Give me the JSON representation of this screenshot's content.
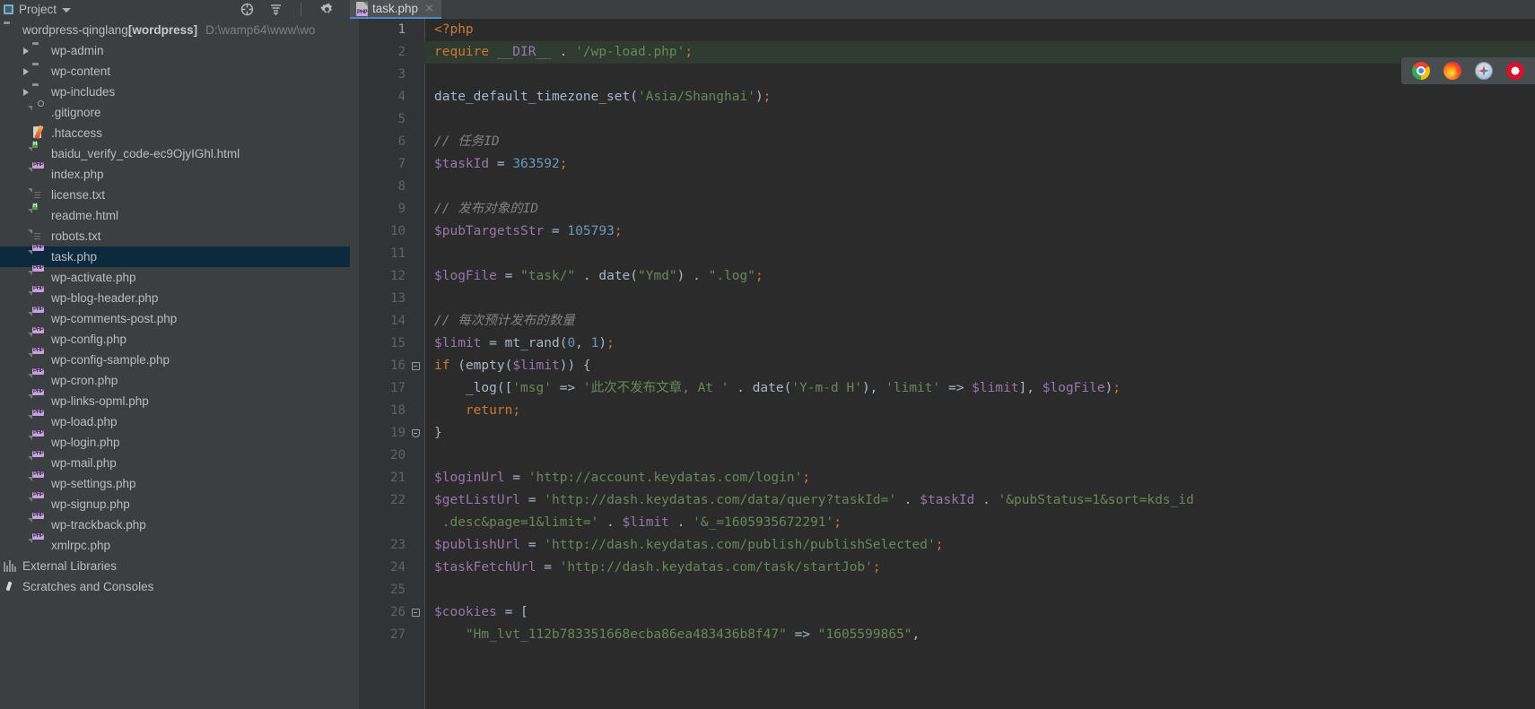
{
  "toolwindow": {
    "title": "Project",
    "icons": [
      "locate-icon",
      "collapse-all-icon",
      "gear-icon",
      "minimize-icon"
    ]
  },
  "editor_tab": {
    "filename": "task.php",
    "icon": "php-file-icon",
    "close": "×"
  },
  "project_tree": [
    {
      "label": "wordpress-qinglang",
      "bold": "[wordpress]",
      "path": "D:\\wamp64\\www\\wo",
      "icon": "folder-icon",
      "indent": 0,
      "arrow": false,
      "selected": false
    },
    {
      "label": "wp-admin",
      "icon": "folder-icon",
      "indent": 1,
      "arrow": true,
      "selected": false
    },
    {
      "label": "wp-content",
      "icon": "folder-icon",
      "indent": 1,
      "arrow": true,
      "selected": false
    },
    {
      "label": "wp-includes",
      "icon": "folder-icon",
      "indent": 1,
      "arrow": true,
      "selected": false
    },
    {
      "label": ".gitignore",
      "icon": "file-ignored-icon",
      "indent": 1,
      "arrow": false,
      "selected": false
    },
    {
      "label": ".htaccess",
      "icon": "htaccess-file-icon",
      "indent": 1,
      "arrow": false,
      "selected": false
    },
    {
      "label": "baidu_verify_code-ec9OjyIGhl.html",
      "icon": "html-file-icon",
      "indent": 1,
      "arrow": false,
      "selected": false
    },
    {
      "label": "index.php",
      "icon": "php-file-icon",
      "indent": 1,
      "arrow": false,
      "selected": false
    },
    {
      "label": "license.txt",
      "icon": "text-file-icon",
      "indent": 1,
      "arrow": false,
      "selected": false
    },
    {
      "label": "readme.html",
      "icon": "html-file-icon",
      "indent": 1,
      "arrow": false,
      "selected": false
    },
    {
      "label": "robots.txt",
      "icon": "text-file-icon",
      "indent": 1,
      "arrow": false,
      "selected": false
    },
    {
      "label": "task.php",
      "icon": "php-file-icon",
      "indent": 1,
      "arrow": false,
      "selected": true
    },
    {
      "label": "wp-activate.php",
      "icon": "php-file-icon",
      "indent": 1,
      "arrow": false,
      "selected": false
    },
    {
      "label": "wp-blog-header.php",
      "icon": "php-file-icon",
      "indent": 1,
      "arrow": false,
      "selected": false
    },
    {
      "label": "wp-comments-post.php",
      "icon": "php-file-icon",
      "indent": 1,
      "arrow": false,
      "selected": false
    },
    {
      "label": "wp-config.php",
      "icon": "php-file-icon",
      "indent": 1,
      "arrow": false,
      "selected": false
    },
    {
      "label": "wp-config-sample.php",
      "icon": "php-file-icon",
      "indent": 1,
      "arrow": false,
      "selected": false
    },
    {
      "label": "wp-cron.php",
      "icon": "php-file-icon",
      "indent": 1,
      "arrow": false,
      "selected": false
    },
    {
      "label": "wp-links-opml.php",
      "icon": "php-file-icon",
      "indent": 1,
      "arrow": false,
      "selected": false
    },
    {
      "label": "wp-load.php",
      "icon": "php-file-icon",
      "indent": 1,
      "arrow": false,
      "selected": false
    },
    {
      "label": "wp-login.php",
      "icon": "php-file-icon",
      "indent": 1,
      "arrow": false,
      "selected": false
    },
    {
      "label": "wp-mail.php",
      "icon": "php-file-icon",
      "indent": 1,
      "arrow": false,
      "selected": false
    },
    {
      "label": "wp-settings.php",
      "icon": "php-file-icon",
      "indent": 1,
      "arrow": false,
      "selected": false
    },
    {
      "label": "wp-signup.php",
      "icon": "php-file-icon",
      "indent": 1,
      "arrow": false,
      "selected": false
    },
    {
      "label": "wp-trackback.php",
      "icon": "php-file-icon",
      "indent": 1,
      "arrow": false,
      "selected": false
    },
    {
      "label": "xmlrpc.php",
      "icon": "php-file-icon",
      "indent": 1,
      "arrow": false,
      "selected": false
    },
    {
      "label": "External Libraries",
      "icon": "external-libraries-icon",
      "indent": 0,
      "arrow": false,
      "selected": false
    },
    {
      "label": "Scratches and Consoles",
      "icon": "scratches-icon",
      "indent": 0,
      "arrow": false,
      "selected": false
    }
  ],
  "code": {
    "first_line_number": 1,
    "lines": [
      {
        "num": "1",
        "fold": "",
        "modified": false,
        "tokens": [
          {
            "t": "<?php",
            "c": "k"
          }
        ]
      },
      {
        "num": "2",
        "fold": "",
        "modified": true,
        "tokens": [
          {
            "t": "require",
            "c": "k"
          },
          {
            "t": " ",
            "c": "p"
          },
          {
            "t": "__DIR__",
            "c": "cn"
          },
          {
            "t": " . ",
            "c": "f"
          },
          {
            "t": "'/wp-load.php'",
            "c": "s"
          },
          {
            "t": ";",
            "c": "k"
          }
        ]
      },
      {
        "num": "3",
        "fold": "",
        "modified": false,
        "tokens": []
      },
      {
        "num": "4",
        "fold": "",
        "modified": false,
        "tokens": [
          {
            "t": "date_default_timezone_set",
            "c": "f"
          },
          {
            "t": "(",
            "c": "p"
          },
          {
            "t": "'Asia/Shanghai'",
            "c": "s"
          },
          {
            "t": ")",
            "c": "p"
          },
          {
            "t": ";",
            "c": "k"
          }
        ]
      },
      {
        "num": "5",
        "fold": "",
        "modified": false,
        "tokens": []
      },
      {
        "num": "6",
        "fold": "",
        "modified": false,
        "tokens": [
          {
            "t": "// 任务ID",
            "c": "c"
          }
        ]
      },
      {
        "num": "7",
        "fold": "",
        "modified": false,
        "tokens": [
          {
            "t": "$taskId",
            "c": "v"
          },
          {
            "t": " = ",
            "c": "f"
          },
          {
            "t": "363592",
            "c": "n"
          },
          {
            "t": ";",
            "c": "k"
          }
        ]
      },
      {
        "num": "8",
        "fold": "",
        "modified": false,
        "tokens": []
      },
      {
        "num": "9",
        "fold": "",
        "modified": false,
        "tokens": [
          {
            "t": "// 发布对象的ID",
            "c": "c"
          }
        ]
      },
      {
        "num": "10",
        "fold": "",
        "modified": false,
        "tokens": [
          {
            "t": "$pubTargetsStr",
            "c": "v"
          },
          {
            "t": " = ",
            "c": "f"
          },
          {
            "t": "105793",
            "c": "n"
          },
          {
            "t": ";",
            "c": "k"
          }
        ]
      },
      {
        "num": "11",
        "fold": "",
        "modified": false,
        "tokens": []
      },
      {
        "num": "12",
        "fold": "",
        "modified": false,
        "tokens": [
          {
            "t": "$logFile",
            "c": "v"
          },
          {
            "t": " = ",
            "c": "f"
          },
          {
            "t": "\"task/\"",
            "c": "s"
          },
          {
            "t": " . ",
            "c": "f"
          },
          {
            "t": "date",
            "c": "f"
          },
          {
            "t": "(",
            "c": "p"
          },
          {
            "t": "\"Ymd\"",
            "c": "s"
          },
          {
            "t": ")",
            "c": "p"
          },
          {
            "t": " . ",
            "c": "f"
          },
          {
            "t": "\".log\"",
            "c": "s"
          },
          {
            "t": ";",
            "c": "k"
          }
        ]
      },
      {
        "num": "13",
        "fold": "",
        "modified": false,
        "tokens": []
      },
      {
        "num": "14",
        "fold": "",
        "modified": false,
        "tokens": [
          {
            "t": "// 每次预计发布的数量",
            "c": "c"
          }
        ]
      },
      {
        "num": "15",
        "fold": "",
        "modified": false,
        "tokens": [
          {
            "t": "$limit",
            "c": "v"
          },
          {
            "t": " = ",
            "c": "f"
          },
          {
            "t": "mt_rand",
            "c": "f"
          },
          {
            "t": "(",
            "c": "p"
          },
          {
            "t": "0",
            "c": "n"
          },
          {
            "t": ", ",
            "c": "p"
          },
          {
            "t": "1",
            "c": "n"
          },
          {
            "t": ")",
            "c": "p"
          },
          {
            "t": ";",
            "c": "k"
          }
        ]
      },
      {
        "num": "16",
        "fold": "start",
        "modified": false,
        "tokens": [
          {
            "t": "if",
            "c": "k"
          },
          {
            "t": " (",
            "c": "p"
          },
          {
            "t": "empty",
            "c": "f"
          },
          {
            "t": "(",
            "c": "p"
          },
          {
            "t": "$limit",
            "c": "v"
          },
          {
            "t": ")) {",
            "c": "p"
          }
        ]
      },
      {
        "num": "17",
        "fold": "",
        "modified": false,
        "tokens": [
          {
            "t": "    _log",
            "c": "f"
          },
          {
            "t": "([",
            "c": "p"
          },
          {
            "t": "'msg'",
            "c": "s"
          },
          {
            "t": " => ",
            "c": "f"
          },
          {
            "t": "'此次不发布文章, At '",
            "c": "s"
          },
          {
            "t": " . ",
            "c": "f"
          },
          {
            "t": "date",
            "c": "f"
          },
          {
            "t": "(",
            "c": "p"
          },
          {
            "t": "'Y-m-d H'",
            "c": "s"
          },
          {
            "t": ")",
            "c": "p"
          },
          {
            "t": ", ",
            "c": "p"
          },
          {
            "t": "'limit'",
            "c": "s"
          },
          {
            "t": " => ",
            "c": "f"
          },
          {
            "t": "$limit",
            "c": "v"
          },
          {
            "t": "], ",
            "c": "p"
          },
          {
            "t": "$logFile",
            "c": "v"
          },
          {
            "t": ")",
            "c": "p"
          },
          {
            "t": ";",
            "c": "k"
          }
        ]
      },
      {
        "num": "18",
        "fold": "",
        "modified": false,
        "tokens": [
          {
            "t": "    ",
            "c": "p"
          },
          {
            "t": "return",
            "c": "k"
          },
          {
            "t": ";",
            "c": "k"
          }
        ]
      },
      {
        "num": "19",
        "fold": "end",
        "modified": false,
        "tokens": [
          {
            "t": "}",
            "c": "p"
          }
        ]
      },
      {
        "num": "20",
        "fold": "",
        "modified": false,
        "tokens": []
      },
      {
        "num": "21",
        "fold": "",
        "modified": false,
        "tokens": [
          {
            "t": "$loginUrl",
            "c": "v"
          },
          {
            "t": " = ",
            "c": "f"
          },
          {
            "t": "'http://account.keydatas.com/login'",
            "c": "s"
          },
          {
            "t": ";",
            "c": "k"
          }
        ]
      },
      {
        "num": "22",
        "fold": "",
        "modified": false,
        "tokens": [
          {
            "t": "$getListUrl",
            "c": "v"
          },
          {
            "t": " = ",
            "c": "f"
          },
          {
            "t": "'http://dash.keydatas.com/data/query?taskId='",
            "c": "s"
          },
          {
            "t": " . ",
            "c": "f"
          },
          {
            "t": "$taskId",
            "c": "v"
          },
          {
            "t": " . ",
            "c": "f"
          },
          {
            "t": "'&pubStatus=1&sort=kds_id",
            "c": "s"
          }
        ]
      },
      {
        "num": "",
        "fold": "",
        "modified": false,
        "tokens": [
          {
            "t": " .desc&page=1&limit='",
            "c": "s"
          },
          {
            "t": " . ",
            "c": "f"
          },
          {
            "t": "$limit",
            "c": "v"
          },
          {
            "t": " . ",
            "c": "f"
          },
          {
            "t": "'&_=1605935672291'",
            "c": "s"
          },
          {
            "t": ";",
            "c": "k"
          }
        ]
      },
      {
        "num": "23",
        "fold": "",
        "modified": false,
        "tokens": [
          {
            "t": "$publishUrl",
            "c": "v"
          },
          {
            "t": " = ",
            "c": "f"
          },
          {
            "t": "'http://dash.keydatas.com/publish/publishSelected'",
            "c": "s"
          },
          {
            "t": ";",
            "c": "k"
          }
        ]
      },
      {
        "num": "24",
        "fold": "",
        "modified": false,
        "tokens": [
          {
            "t": "$taskFetchUrl",
            "c": "v"
          },
          {
            "t": " = ",
            "c": "f"
          },
          {
            "t": "'http://dash.keydatas.com/task/startJob'",
            "c": "s"
          },
          {
            "t": ";",
            "c": "k"
          }
        ]
      },
      {
        "num": "25",
        "fold": "",
        "modified": false,
        "tokens": []
      },
      {
        "num": "26",
        "fold": "start",
        "modified": false,
        "tokens": [
          {
            "t": "$cookies",
            "c": "v"
          },
          {
            "t": " = ",
            "c": "f"
          },
          {
            "t": "[",
            "c": "p"
          }
        ]
      },
      {
        "num": "27",
        "fold": "",
        "modified": false,
        "tokens": [
          {
            "t": "    ",
            "c": "p"
          },
          {
            "t": "\"Hm_lvt_112b783351668ecba86ea483436b8f47\"",
            "c": "s"
          },
          {
            "t": " => ",
            "c": "f"
          },
          {
            "t": "\"1605599865\"",
            "c": "s"
          },
          {
            "t": ",",
            "c": "p"
          }
        ]
      }
    ]
  },
  "browser_bar": {
    "icons": [
      "chrome-icon",
      "firefox-icon",
      "safari-icon",
      "opera-icon"
    ]
  },
  "colors": {
    "accent_tab_underline": "#4a88c7",
    "selection": "#0d293e",
    "editor_bg": "#2b2b2b",
    "panel_bg": "#3c3f41",
    "keyword": "#cc7832",
    "variable": "#9876aa",
    "string": "#6a8759",
    "number": "#6897bb",
    "comment": "#808080",
    "text": "#a9b7c6"
  }
}
